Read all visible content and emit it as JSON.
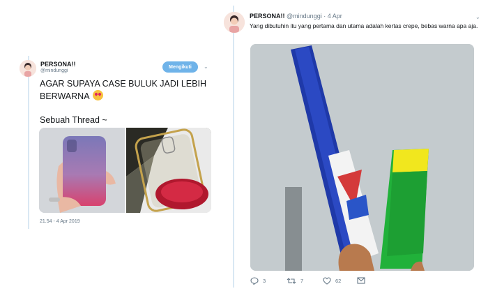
{
  "left_tweet": {
    "name": "PERSONA!!",
    "handle": "@mindunggi",
    "follow_label": "Mengikuti",
    "text_line": "AGAR SUPAYA CASE BULUK JADI LEBIH BERWARNA",
    "emoji": "heart-eyes-emoji",
    "text_line2": "Sebuah Thread ~",
    "timestamp": "21.54 - 4 Apr 2019",
    "images": [
      "hand-holding-gradient-phone-case",
      "clear-phone-case-in-red-dye"
    ]
  },
  "right_tweet": {
    "name": "PERSONA!!",
    "handle_date": "@mindunggi · 4 Apr",
    "text": "Yang dibutuhin itu yang pertama dan utama adalah kertas crepe, bebas warna apa aja.",
    "image": "hand-holding-crepe-paper-rolls",
    "reply_count": "3",
    "retweet_count": "7",
    "like_count": "62"
  },
  "colors": {
    "accent": "#6fb3e9",
    "thread_line": "#d9e8f3",
    "muted": "#657786"
  }
}
